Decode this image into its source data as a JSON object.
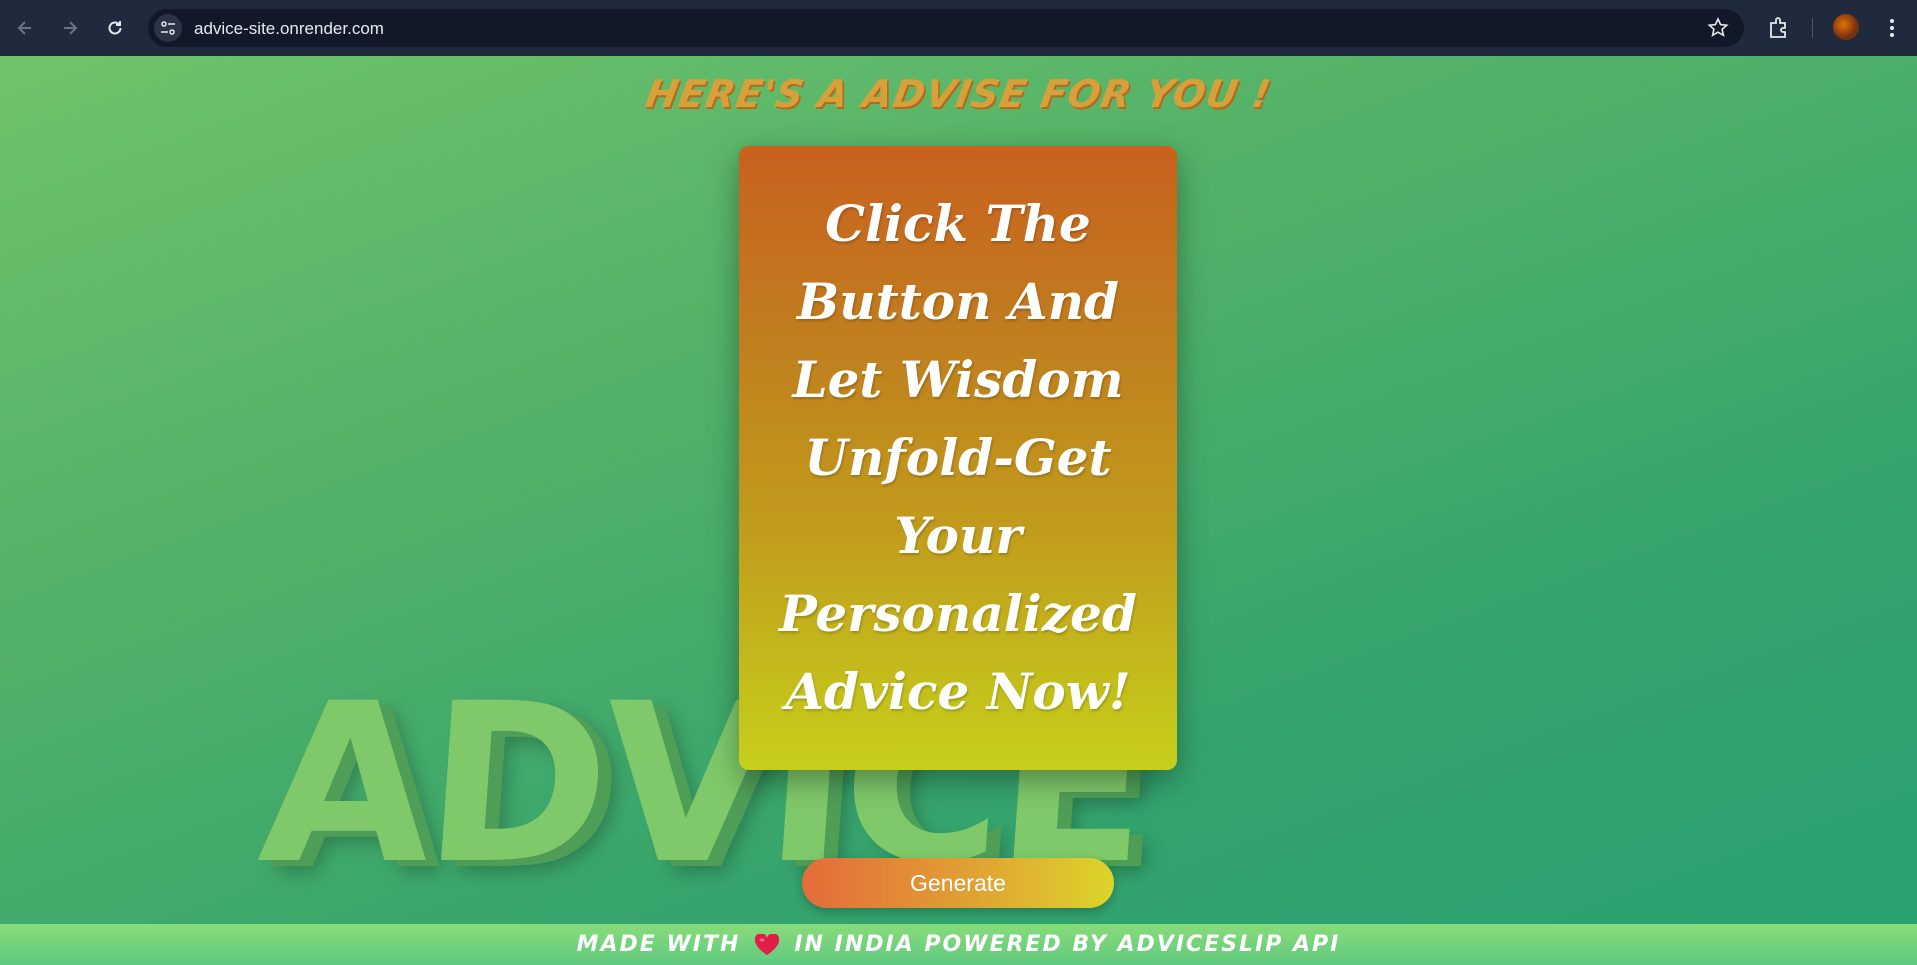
{
  "browser": {
    "url": "advice-site.onrender.com",
    "icons": [
      "back-arrow-icon",
      "forward-arrow-icon",
      "reload-icon",
      "site-settings-icon",
      "bookmark-star-icon",
      "extensions-icon",
      "profile-avatar",
      "menu-kebab-icon"
    ]
  },
  "page": {
    "heading": "HERE'S A ADVISE FOR YOU !",
    "background_word": "ADVICE",
    "card_text": "Click The Button And Let Wisdom Unfold-Get Your Personalized Advice Now!",
    "button_label": "Generate",
    "footer_before": "MADE WITH",
    "footer_after": "IN INDIA POWERED BY ADVICESLIP API"
  },
  "colors": {
    "background_start": "#6fc36a",
    "background_end": "#29a173",
    "card_top": "#c9611f",
    "card_bottom": "#c6d01b",
    "button_start": "#e46b3a",
    "button_end": "#dcd52a",
    "heart": "#e11d48"
  }
}
